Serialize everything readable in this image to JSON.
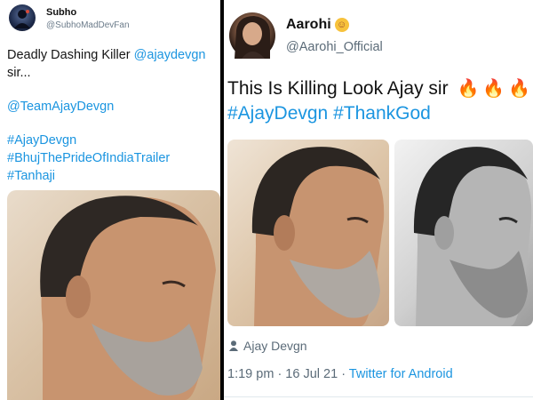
{
  "left_tweet": {
    "name": "Subho",
    "handle": "@SubhoMadDevFan",
    "text_line1_plain": "Deadly Dashing Killer ",
    "text_line1_link": "@ajaydevgn",
    "text_line2": "sir...",
    "mention": "@TeamAjayDevgn",
    "hashtags": [
      "#AjayDevgn",
      "#BhujThePrideOfIndiaTrailer",
      "#Tanhaji"
    ]
  },
  "right_tweet": {
    "name": "Aarohi",
    "handle": "@Aarohi_Official",
    "text": "This Is Killing Look Ajay sir",
    "hashtags": [
      "#AjayDevgn",
      "#ThankGod"
    ],
    "tagged_person": "Ajay Devgn",
    "time": "1:19 pm",
    "date": "16 Jul 21",
    "source": "Twitter for Android"
  },
  "colors": {
    "link": "#1b95e0",
    "secondary_text": "#5b6b78",
    "fire": "#f28b1e"
  },
  "icons": {
    "fire": "fire-emoji",
    "person": "person-icon",
    "badge": "emoji-badge"
  }
}
